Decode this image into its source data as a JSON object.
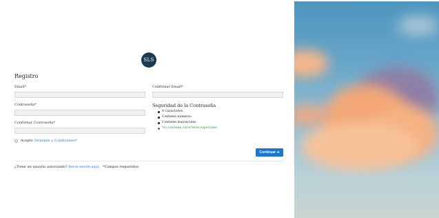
{
  "logo": {
    "text": "SLS"
  },
  "form": {
    "title": "Registro",
    "email_label": "Email*",
    "confirm_email_label": "Confirmar Email*",
    "password_label": "Contraseña*",
    "confirm_password_label": "Confirmar Contraseña*",
    "email_value": "",
    "confirm_email_value": "",
    "password_value": "",
    "confirm_password_value": ""
  },
  "strength": {
    "title": "Seguridad de la Contraseña",
    "rules": [
      {
        "text": "8 Caracteres",
        "ok": false
      },
      {
        "text": "Contiene números",
        "ok": false
      },
      {
        "text": "Contiene mayúsculas",
        "ok": false
      },
      {
        "text": "No contiene caracteres especiales",
        "ok": true
      }
    ]
  },
  "terms": {
    "accept_label": "Acepto",
    "link_label": "Términos y Condiciones*",
    "checked": false
  },
  "continue_button": {
    "label": "Continuar",
    "icon": "arrow-right-icon"
  },
  "footer": {
    "question": "¿Tiene un usuario autorizado?",
    "login_link": "Inicie sesión aquí",
    "required_note": "*Campos requeridos"
  },
  "colors": {
    "primary": "#1976d2",
    "link": "#2a6fd6",
    "ok": "#2f9a2f",
    "logo_bg": "#1d3a55"
  }
}
